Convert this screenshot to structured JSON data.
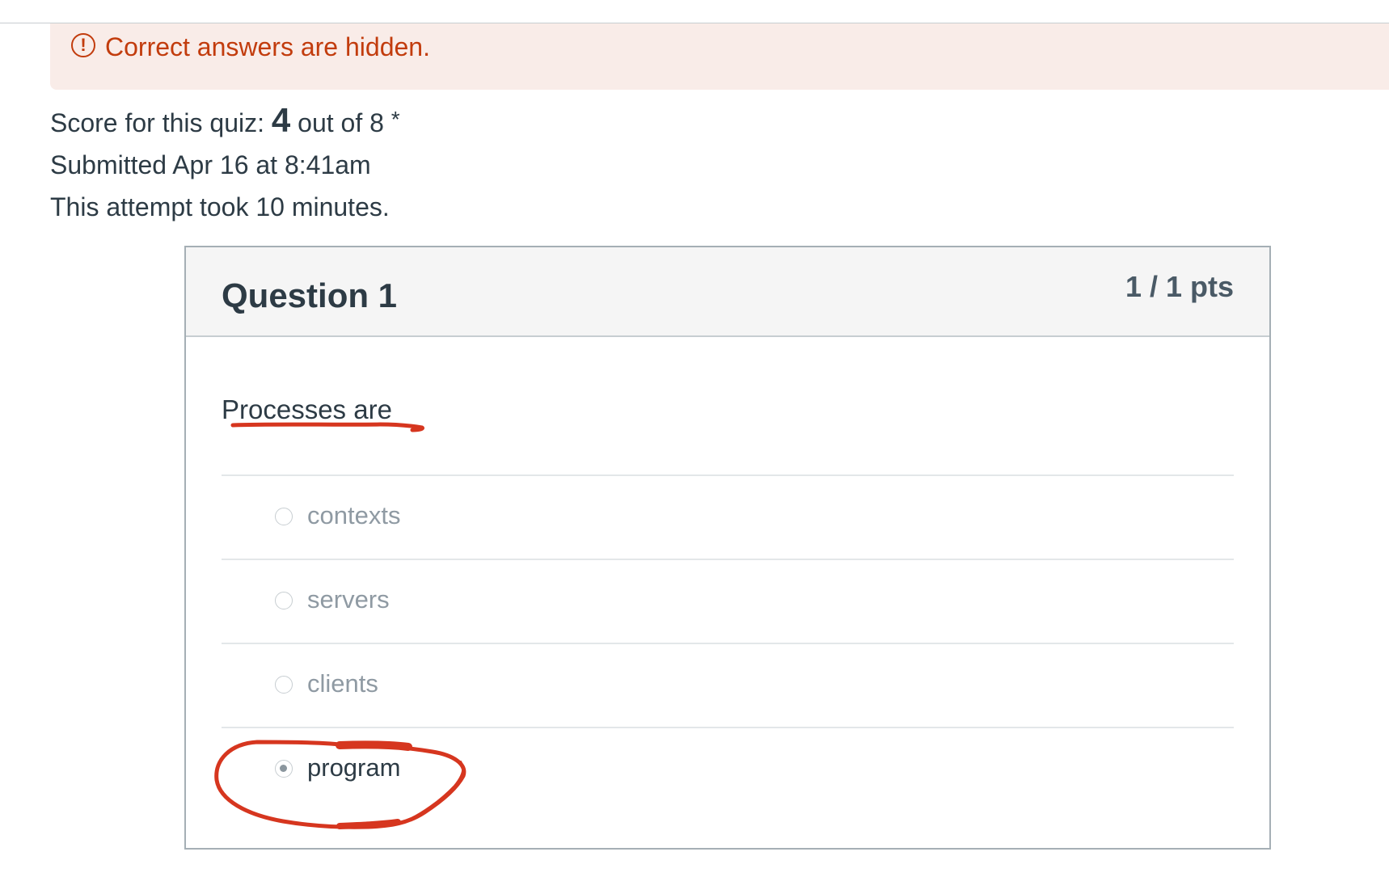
{
  "alert": {
    "icon": "exclamation-circle-icon",
    "text": "Correct answers are hidden.",
    "color": "#c23c0d",
    "background": "#f9ece8"
  },
  "summary": {
    "score_prefix": "Score for this quiz: ",
    "score": "4",
    "score_suffix": " out of 8 ",
    "asterisk": "*",
    "submitted": "Submitted Apr 16 at 8:41am",
    "duration": "This attempt took 10 minutes."
  },
  "question": {
    "title": "Question 1",
    "points": "1 / 1 pts",
    "text": "Processes are",
    "answers": [
      {
        "label": "contexts",
        "selected": false
      },
      {
        "label": "servers",
        "selected": false
      },
      {
        "label": "clients",
        "selected": false
      },
      {
        "label": "program",
        "selected": true
      }
    ]
  },
  "annotation": {
    "color": "#d6361f"
  }
}
